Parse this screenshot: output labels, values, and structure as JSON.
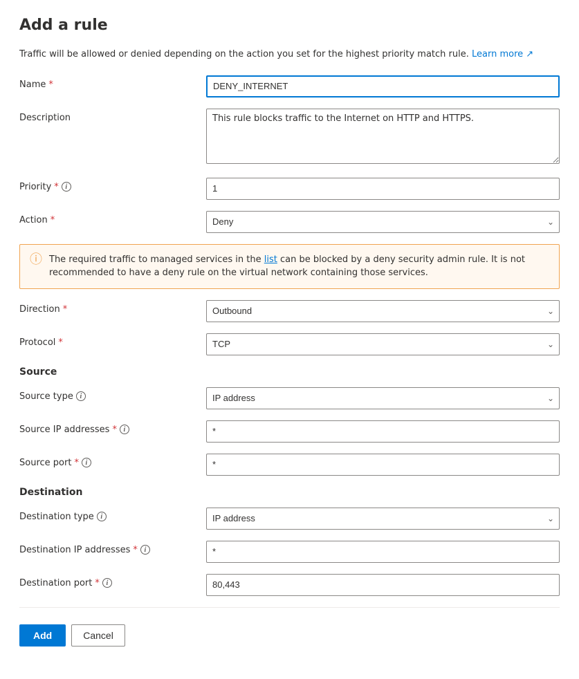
{
  "page": {
    "title": "Add a rule",
    "intro": "Traffic will be allowed or denied depending on the action you set for the highest priority match rule.",
    "learn_more_label": "Learn more",
    "external_link_symbol": "↗"
  },
  "fields": {
    "name_label": "Name",
    "name_value": "DENY_INTERNET",
    "description_label": "Description",
    "description_value": "This rule blocks traffic to the Internet on HTTP and HTTPS.",
    "priority_label": "Priority",
    "priority_value": "1",
    "action_label": "Action",
    "action_value": "Deny",
    "direction_label": "Direction",
    "direction_value": "Outbound",
    "protocol_label": "Protocol",
    "protocol_value": "TCP"
  },
  "warning": {
    "text_before": "The required traffic to managed services in the",
    "link_text": "list",
    "text_after": "can be blocked by a deny security admin rule. It is not recommended to have a deny rule on the virtual network containing those services."
  },
  "source_section": {
    "header": "Source",
    "source_type_label": "Source type",
    "source_type_value": "IP address",
    "source_ip_label": "Source IP addresses",
    "source_ip_value": "*",
    "source_port_label": "Source port",
    "source_port_value": "*"
  },
  "destination_section": {
    "header": "Destination",
    "dest_type_label": "Destination type",
    "dest_type_value": "IP address",
    "dest_ip_label": "Destination IP addresses",
    "dest_ip_value": "*",
    "dest_port_label": "Destination port",
    "dest_port_value": "80,443"
  },
  "buttons": {
    "add_label": "Add",
    "cancel_label": "Cancel"
  },
  "icons": {
    "info": "i",
    "chevron": "∨",
    "warning": "⚠",
    "external_link": "⧉"
  }
}
